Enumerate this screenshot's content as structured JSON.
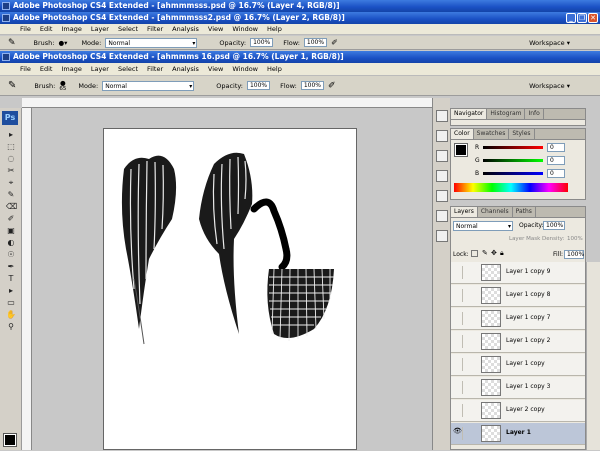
{
  "windows": [
    {
      "title": "Adobe Photoshop CS4 Extended - [ahmmmsss.psd @ 16.7% (Layer 4, RGB/8)]"
    },
    {
      "title": "Adobe Photoshop CS4 Extended - [ahmmmsss2.psd @ 16.7% (Layer 2, RGB/8)]"
    },
    {
      "title": "Adobe Photoshop CS4 Extended - [ahmmms 16.psd @ 16.7% (Layer 1, RGB/8)]"
    }
  ],
  "window_buttons": {
    "minimize": "_",
    "restore": "❐",
    "close": "✕"
  },
  "menu": [
    "File",
    "Edit",
    "Image",
    "Layer",
    "Select",
    "Filter",
    "Analysis",
    "View",
    "Window",
    "Help"
  ],
  "options": {
    "brush_label": "Brush:",
    "brush_size": "65",
    "mode_label": "Mode:",
    "mode_value": "Normal",
    "opacity_label": "Opacity:",
    "opacity_value": "100%",
    "flow_label": "Flow:",
    "flow_value": "100%",
    "workspace": "Workspace ▾"
  },
  "icons": {
    "brush": "brush-icon",
    "airbrush": "airbrush-icon",
    "ps_logo": "Ps"
  },
  "tool_glyphs": [
    "▸",
    "⬚",
    "◌",
    "✂",
    "⌖",
    "✎",
    "⌫",
    "✐",
    "▣",
    "◐",
    "☉",
    "✒",
    "T",
    "▸",
    "▭",
    "✋",
    "⚲"
  ],
  "panels": {
    "navigator_tabs": [
      "Navigator",
      "Histogram",
      "Info"
    ],
    "color_tabs": [
      "Color",
      "Swatches",
      "Styles"
    ],
    "color": {
      "r_label": "R",
      "g_label": "G",
      "b_label": "B",
      "r": "0",
      "g": "0",
      "b": "0"
    },
    "layers_tabs": [
      "Layers",
      "Channels",
      "Paths"
    ],
    "layers": {
      "blend_mode": "Normal",
      "opacity_label": "Opacity:",
      "opacity": "100%",
      "density_label": "Layer Mask Density:",
      "density": "100%",
      "lock_label": "Lock:",
      "fill_label": "Fill:",
      "fill": "100%",
      "items": [
        "Layer 1 copy 9",
        "Layer 1 copy 8",
        "Layer 1 copy 7",
        "Layer 1 copy 2",
        "Layer 1 copy",
        "Layer 1 copy 3",
        "Layer 2 copy",
        "Layer 1"
      ],
      "active_index": 7
    }
  },
  "colors": {
    "accent": "#1a50c4",
    "canvas": "#ffffff",
    "selection": "#bcc6d8"
  }
}
